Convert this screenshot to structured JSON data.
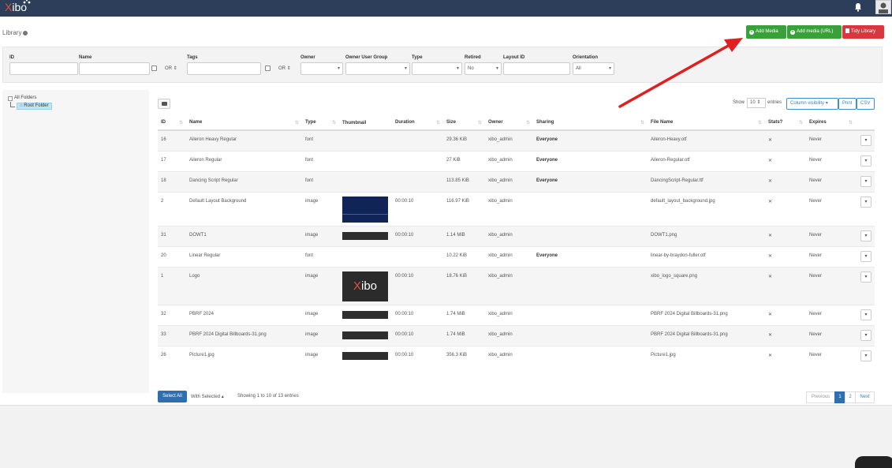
{
  "app": {
    "logo_prefix": "X",
    "logo_main": "ibo"
  },
  "page": {
    "title": "Library"
  },
  "header_buttons": {
    "add_media": "Add Media",
    "add_media_url": "Add media (URL)",
    "tidy_library": "Tidy Library"
  },
  "filters": {
    "id_label": "ID",
    "name_label": "Name",
    "name_logic": "OR",
    "tags_label": "Tags",
    "tags_logic": "OR",
    "owner_label": "Owner",
    "owner_user_group_label": "Owner User Group",
    "type_label": "Type",
    "retired_label": "Retired",
    "retired_value": "No",
    "layout_id_label": "Layout ID",
    "orientation_label": "Orientation",
    "orientation_value": "All"
  },
  "folders": {
    "all": "All Folders",
    "root": "Root Folder"
  },
  "table_tools": {
    "show": "Show",
    "page_size": "10",
    "entries": "entries",
    "column_visibility": "Column visibility",
    "print": "Print",
    "csv": "CSV"
  },
  "columns": [
    "ID",
    "Name",
    "Type",
    "Thumbnail",
    "Duration",
    "Size",
    "Owner",
    "Sharing",
    "File Name",
    "Stats?",
    "Expires"
  ],
  "rows": [
    {
      "id": "16",
      "name": "Aileron Heavy Regular",
      "type": "font",
      "duration": "",
      "size": "29.36 KiB",
      "owner": "xibo_admin",
      "sharing": "Everyone",
      "file": "Aileron-Heavy.otf",
      "stats": "✕",
      "expires": "Never"
    },
    {
      "id": "17",
      "name": "Aileron Regular",
      "type": "font",
      "duration": "",
      "size": "27 KiB",
      "owner": "xibo_admin",
      "sharing": "Everyone",
      "file": "Aileron-Regular.otf",
      "stats": "✕",
      "expires": "Never"
    },
    {
      "id": "18",
      "name": "Dancing Script Regular",
      "type": "font",
      "duration": "",
      "size": "113.85 KiB",
      "owner": "xibo_admin",
      "sharing": "Everyone",
      "file": "DancingScript-Regular.ttf",
      "stats": "✕",
      "expires": "Never"
    },
    {
      "id": "2",
      "name": "Default Layout Background",
      "type": "image",
      "duration": "00:00:10",
      "size": "116.97 KiB",
      "owner": "xibo_admin",
      "sharing": "",
      "file": "default_layout_background.jpg",
      "stats": "✕",
      "expires": "Never"
    },
    {
      "id": "31",
      "name": "DOWT1",
      "type": "image",
      "duration": "00:00:10",
      "size": "1.14 MiB",
      "owner": "xibo_admin",
      "sharing": "",
      "file": "DOWT1.png",
      "stats": "✕",
      "expires": "Never"
    },
    {
      "id": "20",
      "name": "Linear Regular",
      "type": "font",
      "duration": "",
      "size": "10.22 KiB",
      "owner": "xibo_admin",
      "sharing": "Everyone",
      "file": "linear-by-braydon-fuller.otf",
      "stats": "✕",
      "expires": "Never"
    },
    {
      "id": "1",
      "name": "Logo",
      "type": "image",
      "duration": "00:00:10",
      "size": "18.76 KiB",
      "owner": "xibo_admin",
      "sharing": "",
      "file": "xibo_logo_square.png",
      "stats": "✕",
      "expires": "Never"
    },
    {
      "id": "32",
      "name": "PBRF 2024",
      "type": "image",
      "duration": "00:00:10",
      "size": "1.74 MiB",
      "owner": "xibo_admin",
      "sharing": "",
      "file": "PBRF 2024 Digital Billboards-31.png",
      "stats": "✕",
      "expires": "Never"
    },
    {
      "id": "33",
      "name": "PBRF 2024 Digital Billboards-31.png",
      "type": "image",
      "duration": "00:00:10",
      "size": "1.74 MiB",
      "owner": "xibo_admin",
      "sharing": "",
      "file": "PBRF 2024 Digital Billboards-31.png",
      "stats": "✕",
      "expires": "Never"
    },
    {
      "id": "26",
      "name": "Picture1.jpg",
      "type": "image",
      "duration": "00:00:10",
      "size": "356.3 KiB",
      "owner": "xibo_admin",
      "sharing": "",
      "file": "Picture1.jpg",
      "stats": "✕",
      "expires": "Never"
    }
  ],
  "footer": {
    "select_all": "Select All",
    "with_selected": "With Selected",
    "showing": "Showing 1 to 10 of 13 entries",
    "previous": "Previous",
    "page1": "1",
    "page2": "2",
    "next": "Next"
  },
  "colors": {
    "topbar": "#2c3e5a",
    "success": "#3aa13a",
    "danger": "#d9363e",
    "primary": "#2f6fb0",
    "arrow": "#e02020"
  }
}
